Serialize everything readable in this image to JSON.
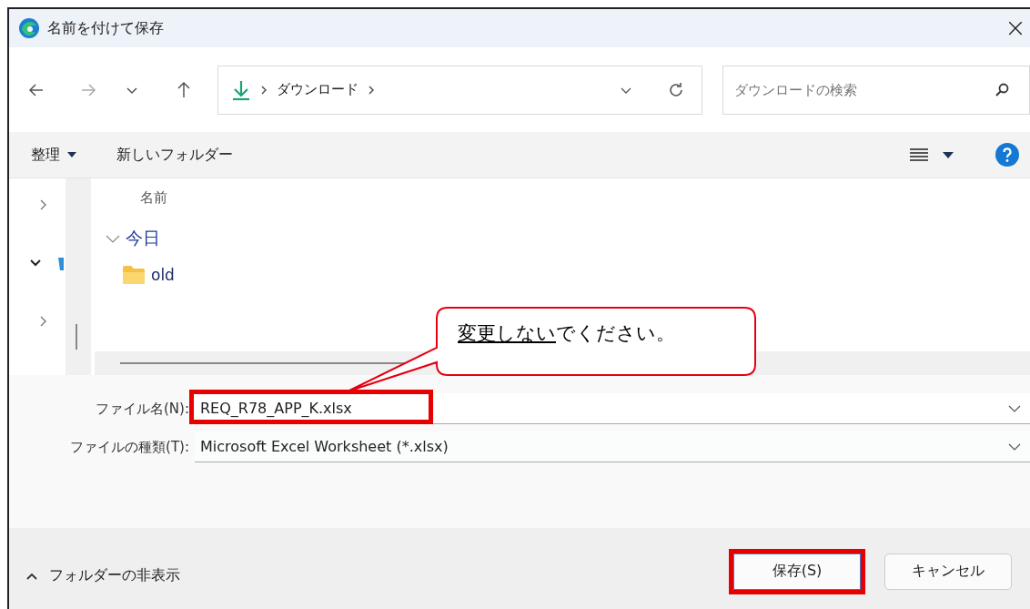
{
  "window": {
    "title": "名前を付けて保存",
    "close": "×"
  },
  "address_bar": {
    "path": [
      "ダウンロード"
    ]
  },
  "search": {
    "placeholder": "ダウンロードの検索"
  },
  "toolbar": {
    "organize": "整理",
    "new_folder": "新しいフォルダー"
  },
  "nav_pane": {
    "items": [
      {
        "expanded": false
      },
      {
        "expanded": true
      },
      {
        "expanded": false
      }
    ]
  },
  "file_list": {
    "column": "名前",
    "groups": [
      {
        "label": "今日",
        "expanded": true,
        "items": [
          {
            "name": "old",
            "kind": "folder"
          }
        ]
      }
    ]
  },
  "callout": {
    "segments": [
      {
        "text": "変更しない",
        "underlined": true
      },
      {
        "text": "でください。",
        "underlined": false
      }
    ]
  },
  "form": {
    "fields": [
      {
        "label": "ファイル名(N):",
        "value": "REQ_R78_APP_K.xlsx",
        "highlighted": true
      },
      {
        "label": "ファイルの種類(T):",
        "value": "Microsoft Excel Worksheet (*.xlsx)",
        "highlighted": false
      }
    ]
  },
  "footer": {
    "hide_folders": "フォルダーの非表示",
    "buttons": [
      {
        "label": "保存(S)",
        "highlighted": true
      },
      {
        "label": "キャンセル",
        "highlighted": false
      }
    ]
  }
}
